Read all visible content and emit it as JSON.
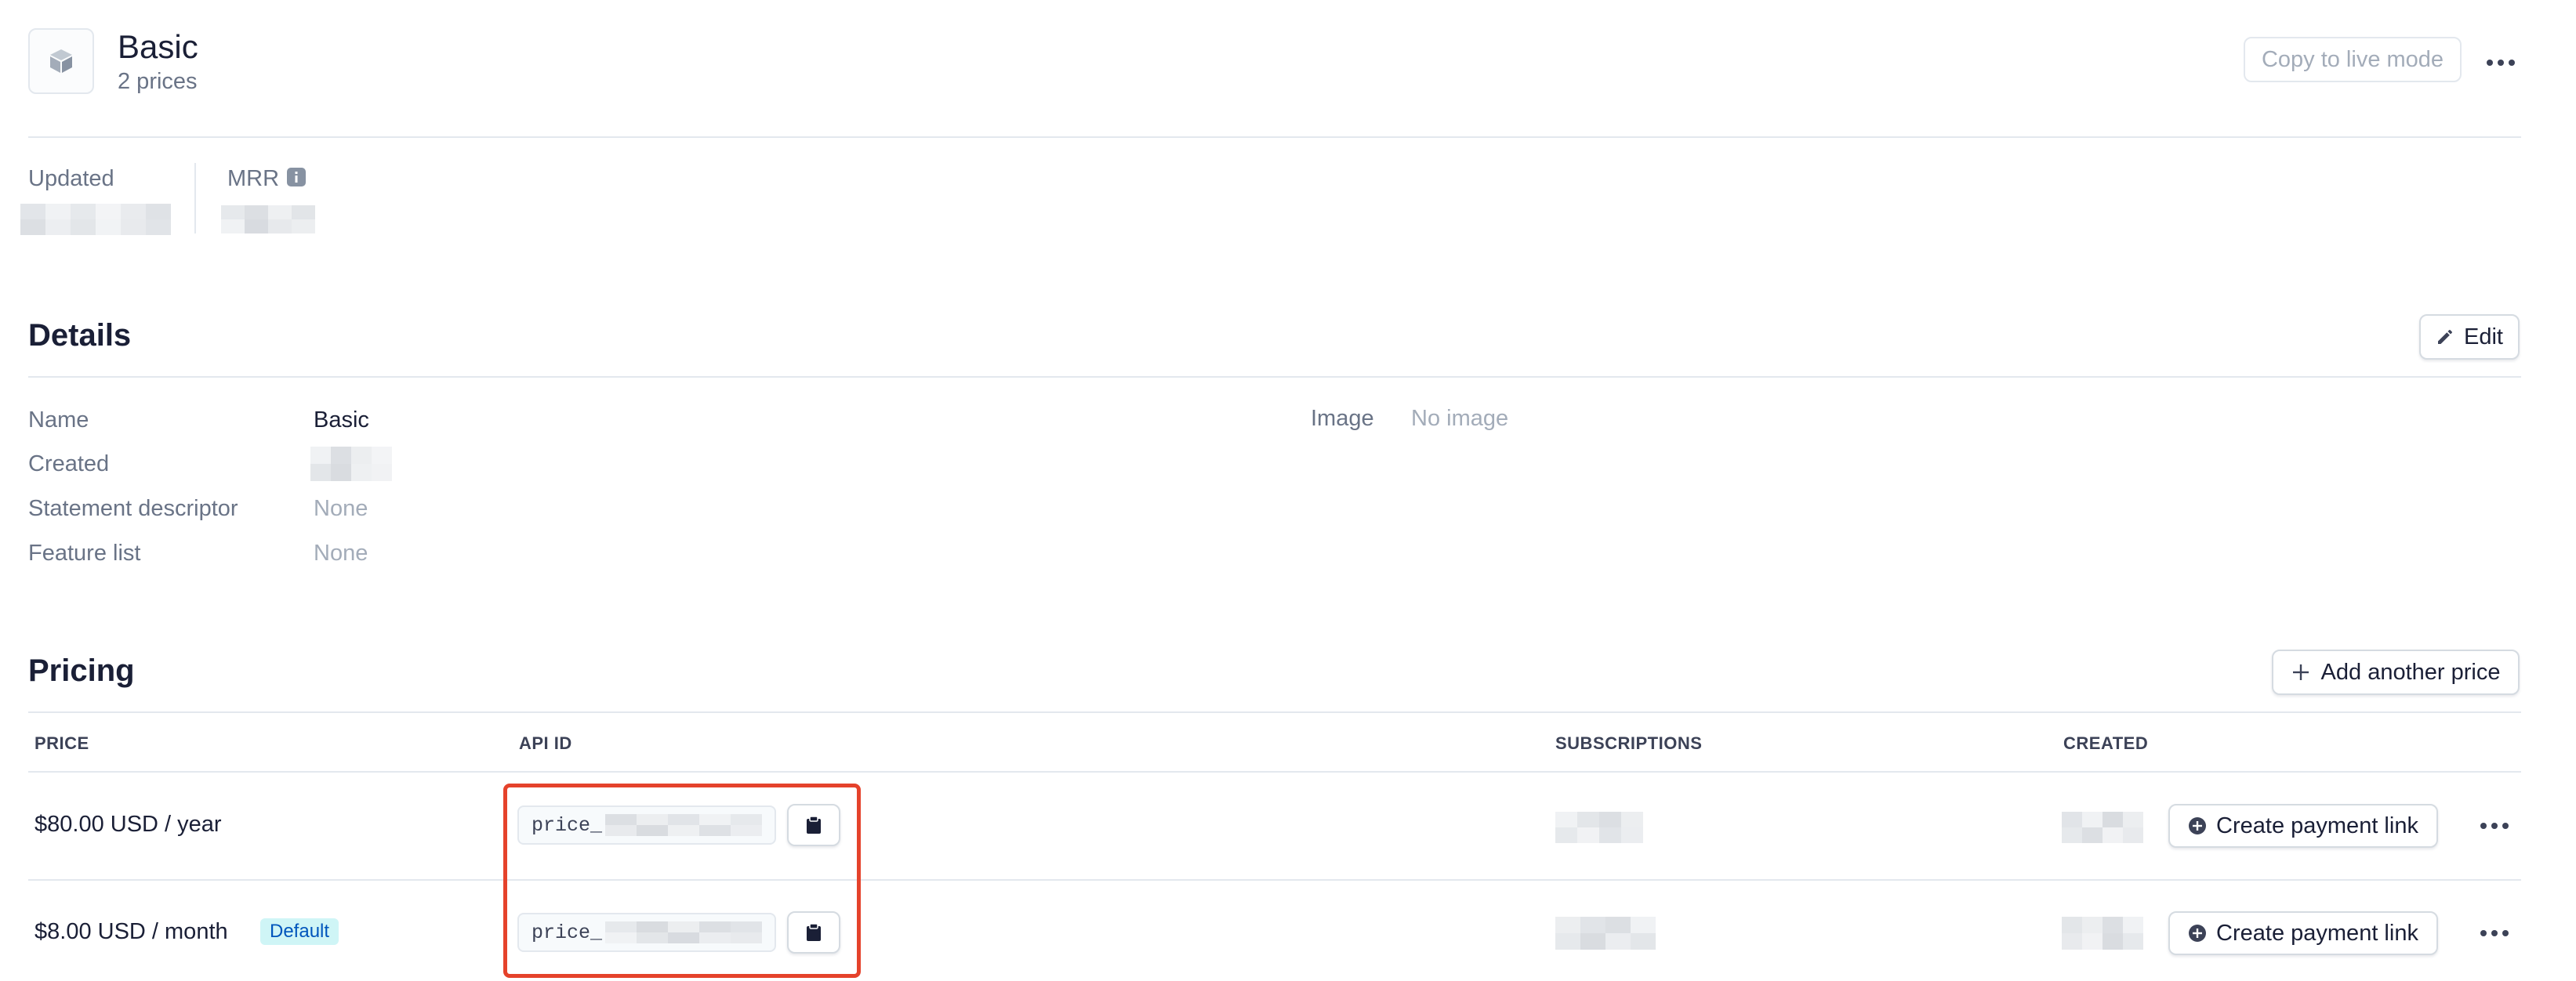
{
  "product": {
    "name": "Basic",
    "subtitle": "2 prices"
  },
  "header": {
    "copy_live_label": "Copy to live mode"
  },
  "stats": {
    "updated_label": "Updated",
    "mrr_label": "MRR"
  },
  "details": {
    "title": "Details",
    "edit_label": "Edit",
    "rows": [
      {
        "label": "Name",
        "value": "Basic"
      },
      {
        "label": "Created",
        "value": ""
      },
      {
        "label": "Statement descriptor",
        "value": "None"
      },
      {
        "label": "Feature list",
        "value": "None"
      }
    ],
    "image_label": "Image",
    "image_value": "No image"
  },
  "pricing": {
    "title": "Pricing",
    "add_label": "Add another price",
    "columns": [
      "PRICE",
      "API ID",
      "SUBSCRIPTIONS",
      "CREATED"
    ],
    "rows": [
      {
        "price": "$80.00 USD / year",
        "badge": "",
        "api_id_prefix": "price_",
        "action": "Create payment link"
      },
      {
        "price": "$8.00 USD / month",
        "badge": "Default",
        "api_id_prefix": "price_",
        "action": "Create payment link"
      }
    ]
  },
  "colors": {
    "highlight": "#e5422b",
    "badge_bg": "#cff5f6",
    "badge_text": "#0055bc"
  },
  "icons": [
    "product-box-icon",
    "more-horizontal-icon",
    "info-icon",
    "pencil-icon",
    "plus-icon",
    "clipboard-icon",
    "plus-circle-icon"
  ]
}
